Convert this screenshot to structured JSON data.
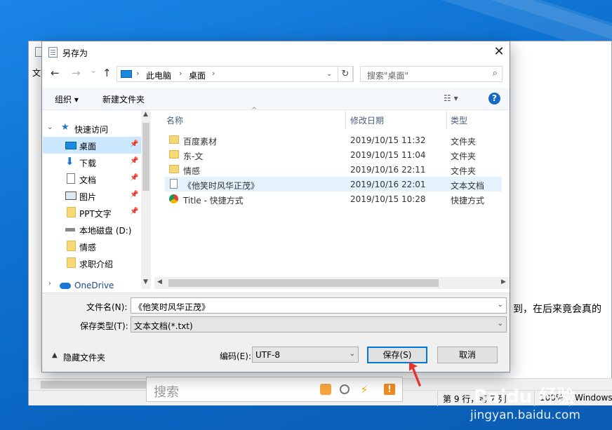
{
  "dialog": {
    "title": "另存为",
    "close": "✕"
  },
  "nav": {
    "back": "←",
    "forward": "→",
    "recent": "⌄",
    "up": "↑",
    "path": [
      "此电脑",
      "桌面"
    ],
    "refresh": "↻",
    "search_placeholder": "搜索\"桌面\""
  },
  "toolbar": {
    "organize": "组织 ▾",
    "new_folder": "新建文件夹",
    "view": "☷ ▾",
    "help": "?"
  },
  "sidebar": {
    "items": [
      {
        "label": "快速访问",
        "icon": "star-icon"
      },
      {
        "label": "桌面",
        "icon": "desktop-icon",
        "pinned": true,
        "selected": true
      },
      {
        "label": "下载",
        "icon": "download-icon",
        "pinned": true
      },
      {
        "label": "文档",
        "icon": "document-icon",
        "pinned": true
      },
      {
        "label": "图片",
        "icon": "picture-icon",
        "pinned": true
      },
      {
        "label": "PPT文字",
        "icon": "folder-icon",
        "pinned": true
      },
      {
        "label": "本地磁盘 (D:)",
        "icon": "drive-icon"
      },
      {
        "label": "情感",
        "icon": "folder-icon"
      },
      {
        "label": "求职介绍",
        "icon": "folder-icon"
      },
      {
        "label": "OneDrive",
        "icon": "cloud-icon"
      }
    ]
  },
  "files": {
    "columns": [
      "名称",
      "修改日期",
      "类型"
    ],
    "rows": [
      {
        "name": "百度素材",
        "date": "2019/10/15 11:32",
        "type": "文件夹",
        "icon": "folder-icon"
      },
      {
        "name": "东-文",
        "date": "2019/10/15 11:04",
        "type": "文件夹",
        "icon": "folder-icon"
      },
      {
        "name": "情感",
        "date": "2019/10/16 22:11",
        "type": "文件夹",
        "icon": "folder-icon"
      },
      {
        "name": "《他笑时风华正茂》",
        "date": "2019/10/16 22:01",
        "type": "文本文档",
        "icon": "text-file-icon",
        "highlighted": true
      },
      {
        "name": "Title - 快捷方式",
        "date": "2019/10/15 10:28",
        "type": "快捷方式",
        "icon": "chrome-shortcut-icon"
      }
    ]
  },
  "form": {
    "filename_label": "文件名(N):",
    "filename_value": "《他笑时风华正茂》",
    "type_label": "保存类型(T):",
    "type_value": "文本文档(*.txt)",
    "hide_folders": "隐藏文件夹",
    "encoding_label": "编码(E):",
    "encoding_value": "UTF-8",
    "save": "保存(S)",
    "cancel": "取消"
  },
  "notepad": {
    "menu": "文",
    "text": "到，在后来竟会真的",
    "status_pos": "第 9 行，第 7 列",
    "status_zoom": "100%",
    "status_eol": "Windows"
  },
  "searchbar": {
    "placeholder": "搜索"
  },
  "watermark": {
    "logo": "Baidu 经验",
    "url": "jingyan.baidu.com"
  }
}
